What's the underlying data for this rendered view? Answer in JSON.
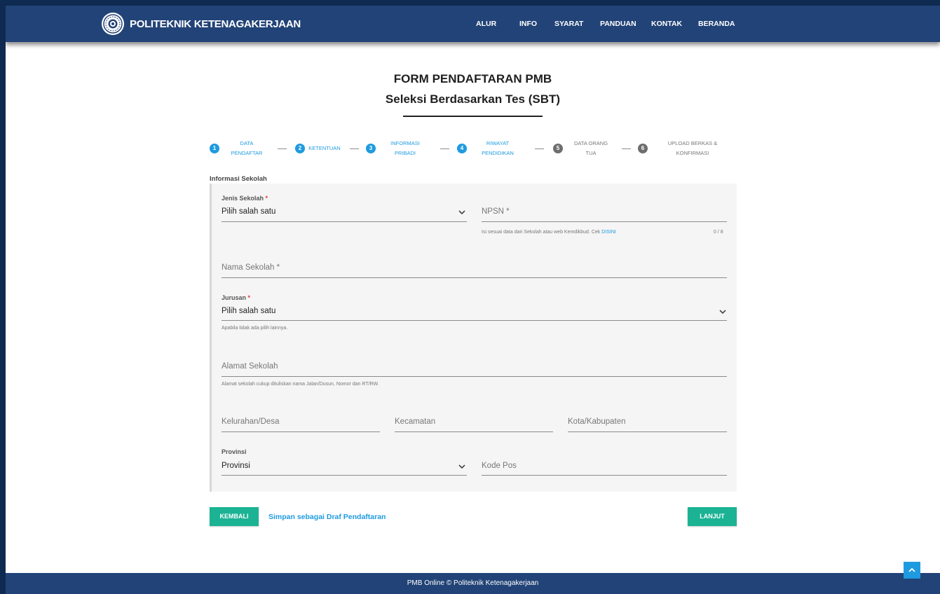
{
  "header": {
    "brand": "POLITEKNIK KETENAGAKERJAAN",
    "nav": [
      "ALUR",
      "INFO",
      "SYARAT",
      "PANDUAN",
      "KONTAK",
      "BERANDA"
    ]
  },
  "title": {
    "line1": "FORM PENDAFTARAN PMB",
    "line2": "Seleksi Berdasarkan Tes (SBT)"
  },
  "stepper": {
    "steps": [
      {
        "num": "1",
        "label1": "DATA",
        "label2": "PENDAFTAR",
        "state": "active"
      },
      {
        "num": "2",
        "label1": "KETENTUAN",
        "label2": "",
        "state": "active"
      },
      {
        "num": "3",
        "label1": "INFORMASI",
        "label2": "PRIBADI",
        "state": "active"
      },
      {
        "num": "4",
        "label1": "RIWAYAT",
        "label2": "PENDIDIKAN",
        "state": "active"
      },
      {
        "num": "5",
        "label1": "DATA ORANG",
        "label2": "TUA",
        "state": "inactive"
      },
      {
        "num": "6",
        "label1": "UPLOAD BERKAS &",
        "label2": "KONFIRMASI",
        "state": "inactive"
      }
    ]
  },
  "section": {
    "title": "Informasi Sekolah"
  },
  "form": {
    "jenis_sekolah": {
      "label": "Jenis Sekolah",
      "required": "*",
      "value": "Pilih salah satu"
    },
    "npsn": {
      "placeholder": "NPSN *",
      "helper": "Isi sesuai data dari Sekolah atau web Kemdikbud. Cek ",
      "helper_link": "DISINI",
      "counter": "0 / 8"
    },
    "nama_sekolah": {
      "placeholder": "Nama Sekolah *"
    },
    "jurusan": {
      "label": "Jurusan",
      "required": "*",
      "value": "Pilih salah satu",
      "helper": "Apabila tidak ada pilih lainnya."
    },
    "alamat_sekolah": {
      "placeholder": "Alamat Sekolah",
      "helper": "Alamat sekolah cukup dituliskan nama Jalan/Dusun, Nomor dan RT/RW."
    },
    "kelurahan": {
      "placeholder": "Kelurahan/Desa"
    },
    "kecamatan": {
      "placeholder": "Kecamatan"
    },
    "kota": {
      "placeholder": "Kota/Kabupaten"
    },
    "provinsi": {
      "label": "Provinsi",
      "value": "Provinsi"
    },
    "kode_pos": {
      "placeholder": "Kode Pos"
    }
  },
  "actions": {
    "back": "KEMBALI",
    "draft": "Simpan sebagai Draf Pendaftaran",
    "next": "LANJUT"
  },
  "footer": {
    "text": "PMB Online © Politeknik Ketenagakerjaan"
  },
  "colors": {
    "navbar": "#224377",
    "accent": "#1e9be0",
    "button": "#1bb394"
  }
}
